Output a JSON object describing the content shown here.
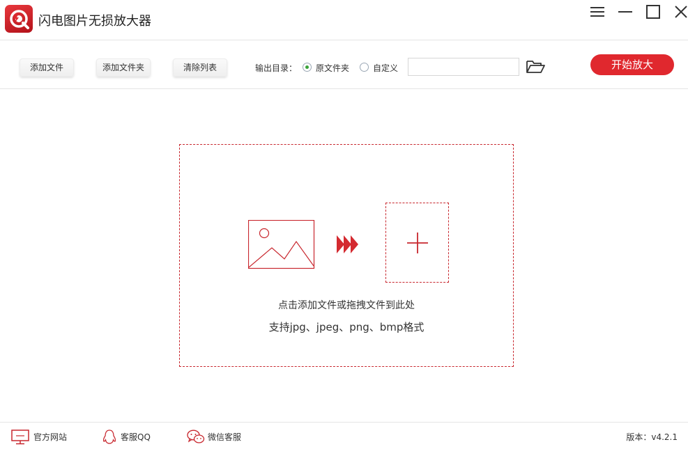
{
  "app": {
    "title": "闪电图片无损放大器",
    "accent_color": "#e0282e",
    "logo_icon": "camera-lens-icon"
  },
  "window_controls": {
    "menu_icon": "hamburger-menu-icon",
    "minimize_icon": "minimize-icon",
    "maximize_icon": "maximize-icon",
    "close_icon": "close-icon"
  },
  "toolbar": {
    "add_file_label": "添加文件",
    "add_folder_label": "添加文件夹",
    "clear_list_label": "清除列表",
    "output_dir_label": "输出目录：",
    "output_options": [
      {
        "label": "原文件夹",
        "checked": true
      },
      {
        "label": "自定义",
        "checked": false
      }
    ],
    "path_value": "",
    "open_folder_icon": "open-folder-icon",
    "start_label": "开始放大"
  },
  "dropzone": {
    "line1": "点击添加文件或拖拽文件到此处",
    "line2": "支持jpg、jpeg、png、bmp格式",
    "image_icon": "image-placeholder-icon",
    "arrows_icon": "triple-arrow-icon",
    "add_icon": "plus-icon"
  },
  "statusbar": {
    "website_label": "官方网站",
    "qq_label": "客服QQ",
    "wechat_label": "微信客服",
    "version_label": "版本：v4.2.1"
  }
}
